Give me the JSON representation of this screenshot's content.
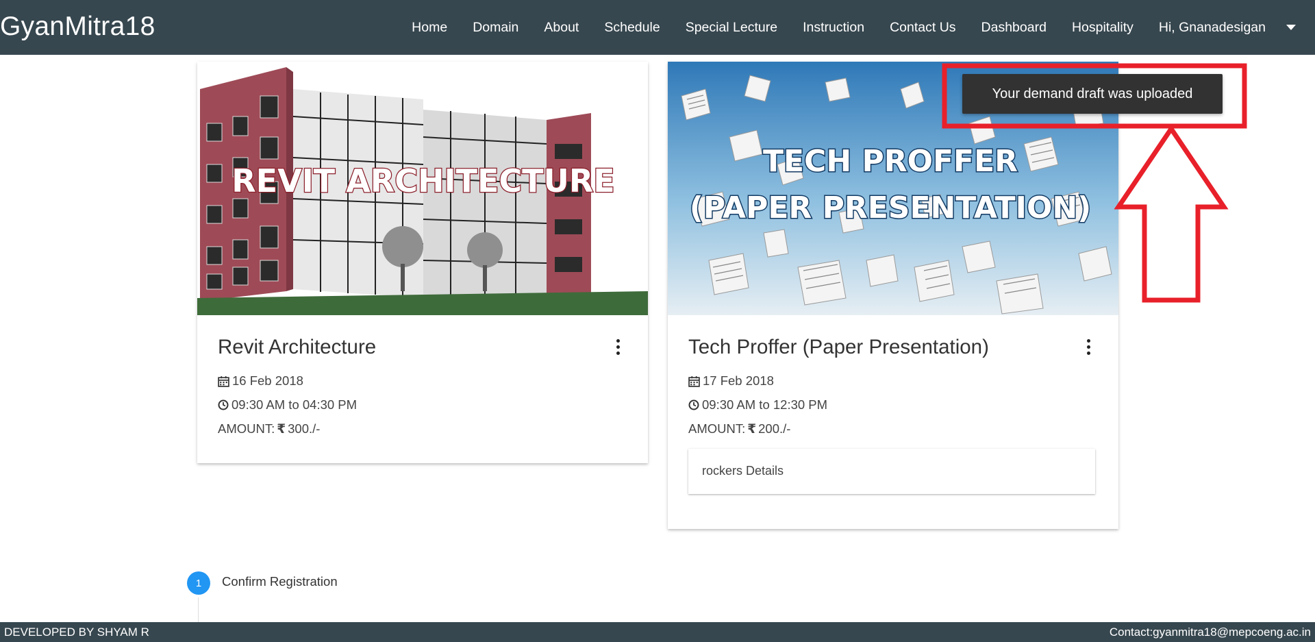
{
  "navbar": {
    "brand": "GyanMitra18",
    "links": [
      "Home",
      "Domain",
      "About",
      "Schedule",
      "Special Lecture",
      "Instruction",
      "Contact Us",
      "Dashboard",
      "Hospitality",
      "Hi, Gnanadesigan"
    ]
  },
  "cards": [
    {
      "banner_text": "REVIT ARCHITECTURE",
      "title": "Revit Architecture",
      "date": "16 Feb 2018",
      "time": "09:30 AM to 04:30 PM",
      "amount_label": "AMOUNT:",
      "amount_value": "300./-"
    },
    {
      "banner_line1": "TECH PROFFER",
      "banner_line2": "(PAPER PRESENTATION)",
      "title": "Tech Proffer (Paper Presentation)",
      "date": "17 Feb 2018",
      "time": "09:30 AM to 12:30 PM",
      "amount_label": "AMOUNT:",
      "amount_value": "200./-",
      "details_label": "rockers Details"
    }
  ],
  "toast": {
    "message": "Your demand draft was uploaded"
  },
  "stepper": {
    "step_number": "1",
    "label": "Confirm Registration"
  },
  "footer": {
    "left": "DEVELOPED BY SHYAM R",
    "right": "Contact:gyanmitra18@mepcoeng.ac.in"
  },
  "colors": {
    "navbar": "#37474f",
    "toast": "#323232",
    "step": "#2196f3",
    "annotation": "#e8202a"
  }
}
